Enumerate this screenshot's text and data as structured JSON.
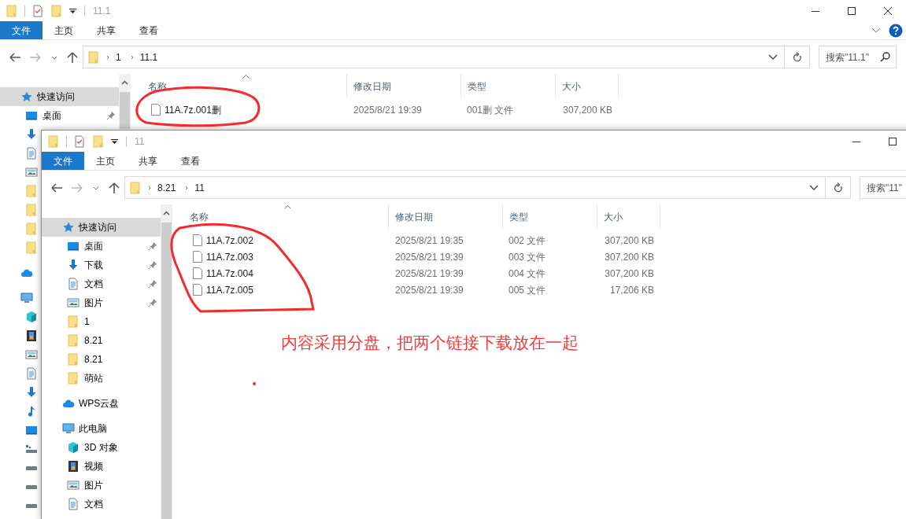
{
  "windows": [
    {
      "title": "11.1",
      "caption_buttons": [
        {
          "kind": "minimize"
        },
        {
          "kind": "maximize"
        },
        {
          "kind": "close"
        }
      ],
      "ribbon_tabs": [
        {
          "label": "文件",
          "selected": true
        },
        {
          "label": "主页",
          "selected": false
        },
        {
          "label": "共享",
          "selected": false
        },
        {
          "label": "查看",
          "selected": false
        }
      ],
      "ribbon_controls": [
        {
          "kind": "expand"
        },
        {
          "kind": "help"
        }
      ],
      "breadcrumb": [
        "1",
        "11.1"
      ],
      "search": {
        "placeholder": "搜索\"11.1\"",
        "icon": true
      },
      "sidebar": [
        {
          "kind": "star",
          "label": "快速访问",
          "selected": true,
          "children": [
            {
              "kind": "desktop",
              "label": "桌面",
              "selected": false,
              "pinned": true
            },
            {
              "kind": "download",
              "selected": false
            },
            {
              "kind": "document",
              "selected": false
            },
            {
              "kind": "picture",
              "selected": false
            },
            {
              "kind": "folder",
              "selected": false
            },
            {
              "kind": "folder",
              "selected": false
            },
            {
              "kind": "folder",
              "selected": false
            },
            {
              "kind": "folder",
              "selected": false
            }
          ]
        },
        {
          "kind": "cloud",
          "selected": false
        },
        {
          "kind": "pc",
          "selected": false,
          "children": [
            {
              "kind": "cube",
              "selected": false
            },
            {
              "kind": "video",
              "selected": false
            },
            {
              "kind": "picture",
              "selected": false
            },
            {
              "kind": "document",
              "selected": false
            },
            {
              "kind": "download",
              "selected": false
            },
            {
              "kind": "music",
              "selected": false
            },
            {
              "kind": "desktop",
              "selected": false
            },
            {
              "kind": "device",
              "selected": false
            },
            {
              "kind": "drive",
              "selected": false
            },
            {
              "kind": "drive",
              "selected": false
            },
            {
              "kind": "drive",
              "selected": false
            }
          ]
        }
      ],
      "columns": [
        {
          "label": "名称",
          "sorted": true
        },
        {
          "label": "修改日期",
          "sorted": false
        },
        {
          "label": "类型",
          "sorted": false
        },
        {
          "label": "大小",
          "sorted": false
        }
      ],
      "files": [
        {
          "name": "11A.7z.001删",
          "modified": "2025/8/21 19:39",
          "type": "001删 文件",
          "size": "307,200 KB"
        }
      ]
    },
    {
      "title": "11",
      "caption_buttons": [
        {
          "kind": "minimize"
        },
        {
          "kind": "maximize"
        }
      ],
      "ribbon_tabs": [
        {
          "label": "文件",
          "selected": true
        },
        {
          "label": "主页",
          "selected": false
        },
        {
          "label": "共享",
          "selected": false
        },
        {
          "label": "查看",
          "selected": false
        }
      ],
      "breadcrumb": [
        "8.21",
        "11"
      ],
      "search": {
        "placeholder": "搜索\"11\"",
        "icon": false
      },
      "sidebar": [
        {
          "kind": "star",
          "label": "快速访问",
          "selected": true,
          "children": [
            {
              "kind": "desktop",
              "label": "桌面",
              "selected": false,
              "pinned": true
            },
            {
              "kind": "download",
              "label": "下载",
              "selected": false,
              "pinned": true
            },
            {
              "kind": "document",
              "label": "文档",
              "selected": false,
              "pinned": true
            },
            {
              "kind": "picture",
              "label": "图片",
              "selected": false,
              "pinned": true
            },
            {
              "kind": "folder",
              "label": "1",
              "selected": false,
              "pinned": false
            },
            {
              "kind": "folder",
              "label": "8.21",
              "selected": false,
              "pinned": false
            },
            {
              "kind": "folder",
              "label": "8.21",
              "selected": false,
              "pinned": false
            },
            {
              "kind": "folder",
              "label": "萌站",
              "selected": false,
              "pinned": false
            }
          ]
        },
        {
          "kind": "cloud",
          "label": "WPS云盘",
          "selected": false
        },
        {
          "kind": "pc",
          "label": "此电脑",
          "selected": false,
          "children": [
            {
              "kind": "cube",
              "label": "3D 对象",
              "selected": false,
              "pinned": false
            },
            {
              "kind": "video",
              "label": "视频",
              "selected": false,
              "pinned": false
            },
            {
              "kind": "picture",
              "label": "图片",
              "selected": false,
              "pinned": false
            },
            {
              "kind": "document",
              "label": "文档",
              "selected": false,
              "pinned": false
            }
          ]
        }
      ],
      "columns": [
        {
          "label": "名称",
          "sorted": true
        },
        {
          "label": "修改日期",
          "sorted": false
        },
        {
          "label": "类型",
          "sorted": false
        },
        {
          "label": "大小",
          "sorted": false
        }
      ],
      "files": [
        {
          "name": "11A.7z.002",
          "modified": "2025/8/21 19:35",
          "type": "002 文件",
          "size": "307,200 KB"
        },
        {
          "name": "11A.7z.003",
          "modified": "2025/8/21 19:39",
          "type": "003 文件",
          "size": "307,200 KB"
        },
        {
          "name": "11A.7z.004",
          "modified": "2025/8/21 19:39",
          "type": "004 文件",
          "size": "307,200 KB"
        },
        {
          "name": "11A.7z.005",
          "modified": "2025/8/21 19:39",
          "type": "005 文件",
          "size": "17,206 KB"
        }
      ]
    }
  ],
  "annotation": {
    "note": "内容采用分盘，把两个链接下载放在一起"
  }
}
